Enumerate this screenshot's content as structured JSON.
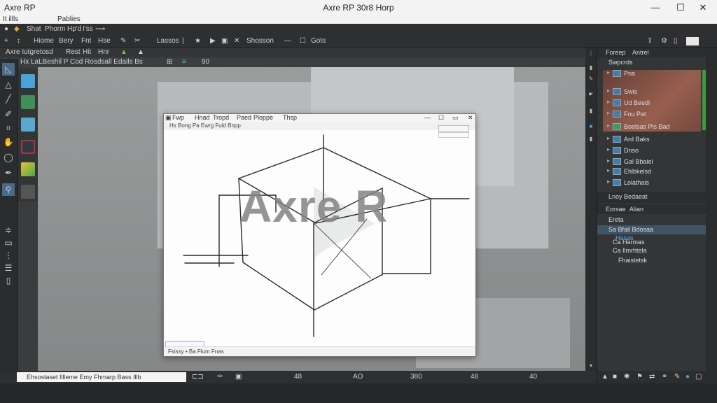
{
  "titlebar": {
    "app_label": "Axre RP",
    "title": "Axre RP 30r8 Horp",
    "minimize": "—",
    "maximize": "☐",
    "close": "✕"
  },
  "menubar": {
    "left": "It illls",
    "right": "Pablies"
  },
  "toolbar1": {
    "items": [
      "Shat",
      "Phorm",
      "Hp'd",
      "I'ss"
    ]
  },
  "toolbar2": {
    "items": [
      "Hiome",
      "Bery",
      "Fnt",
      "Hse",
      "Lassos",
      "Shosson",
      "Gots"
    ]
  },
  "toolbar3": {
    "items": [
      "Axre Iutgretosd",
      "Rest",
      "Hit",
      "Hnr"
    ]
  },
  "toolbar4": {
    "text": "Hz Hx LaLBeshil P Cod Rosdsall Edails Bs",
    "number": "90"
  },
  "inner_window": {
    "title_items": [
      "Fwp",
      "Hnad",
      "Tropd",
      "Paed",
      "Ploppe",
      "Thsp"
    ],
    "subtitle": "Hs Bong Pa Ewrg Fuld Bnpp",
    "status": "Fsissy • Ba Flum Fnas"
  },
  "watermark": "Axre R",
  "bottombar": {
    "tab_label": "Ehsostaset Illleme Emy Fhmarp Bass Illb",
    "numbers": [
      "48",
      "AO",
      "380",
      "48",
      "40"
    ]
  },
  "right_panel": {
    "tabs": [
      "Foreep",
      "Antrel"
    ],
    "header": "Swpcrds",
    "layers": [
      {
        "label": "Pna"
      },
      {
        "label": "Swis"
      },
      {
        "label": "Ud Beedl"
      },
      {
        "label": "Fnu Pat"
      },
      {
        "label": "Boelsas Pls Bad"
      },
      {
        "label": "Ard Baks"
      },
      {
        "label": "Dnso"
      },
      {
        "label": "Gal Bbaiel"
      },
      {
        "label": "Ehlbkelsd"
      },
      {
        "label": "Lolathais"
      }
    ],
    "footer": "Lnoy Bedaeat",
    "tabs2": [
      "Eorsae",
      "Alian"
    ],
    "props": [
      {
        "label": "Ereta"
      },
      {
        "label": "Sa Bfall Bdosaa"
      },
      {
        "label": "Hasas"
      },
      {
        "label": "Ca Harmas"
      },
      {
        "label": "Ca Ilmrhtela"
      },
      {
        "label": "Fhaistetsk"
      }
    ]
  }
}
